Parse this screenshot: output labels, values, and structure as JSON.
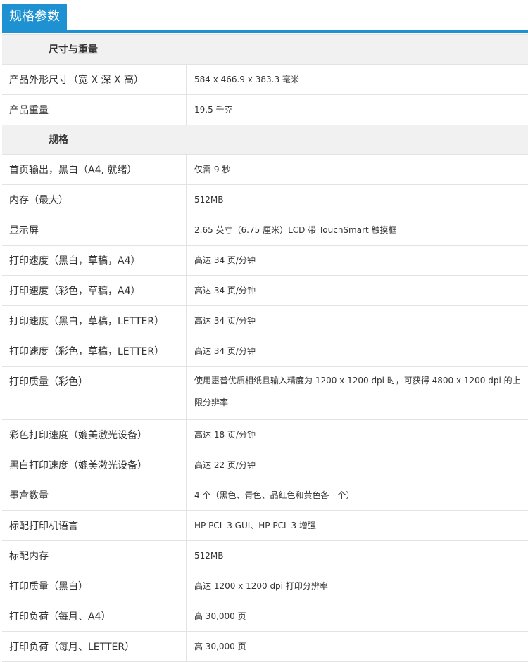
{
  "tab": {
    "label": "规格参数"
  },
  "sections": [
    {
      "title": "尺寸与重量",
      "rows": [
        {
          "label": "产品外形尺寸（宽 X 深 X 高）",
          "value": "584 x 466.9 x 383.3 毫米"
        },
        {
          "label": "产品重量",
          "value": "19.5 千克"
        }
      ]
    },
    {
      "title": "规格",
      "rows": [
        {
          "label": "首页输出，黑白（A4, 就绪）",
          "value": "仅需 9 秒"
        },
        {
          "label": "内存（最大）",
          "value": "512MB"
        },
        {
          "label": "显示屏",
          "value": "2.65 英寸（6.75 厘米）LCD 带 TouchSmart 触摸框"
        },
        {
          "label": "打印速度（黑白，草稿，A4）",
          "value": "高达 34 页/分钟"
        },
        {
          "label": "打印速度（彩色，草稿，A4）",
          "value": "高达 34 页/分钟"
        },
        {
          "label": "打印速度（黑白，草稿，LETTER）",
          "value": "高达 34 页/分钟"
        },
        {
          "label": "打印速度（彩色，草稿，LETTER）",
          "value": "高达 34 页/分钟"
        },
        {
          "label": "打印质量（彩色）",
          "value": "使用惠普优质相纸且输入精度为 1200 x 1200 dpi 时，可获得 4800 x 1200 dpi 的上限分辨率"
        },
        {
          "label": "彩色打印速度（媲美激光设备）",
          "value": "高达 18 页/分钟"
        },
        {
          "label": "黑白打印速度（媲美激光设备）",
          "value": "高达 22 页/分钟"
        },
        {
          "label": "墨盒数量",
          "value": "4 个（黑色、青色、品红色和黄色各一个）"
        },
        {
          "label": "标配打印机语言",
          "value": "HP PCL 3 GUI、HP PCL 3 增强"
        },
        {
          "label": "标配内存",
          "value": "512MB"
        },
        {
          "label": "打印质量（黑白）",
          "value": "高达 1200 x 1200 dpi 打印分辨率"
        },
        {
          "label": "打印负荷（每月、A4）",
          "value": "高 30,000 页"
        },
        {
          "label": "打印负荷（每月、LETTER）",
          "value": "高 30,000 页"
        }
      ]
    }
  ]
}
